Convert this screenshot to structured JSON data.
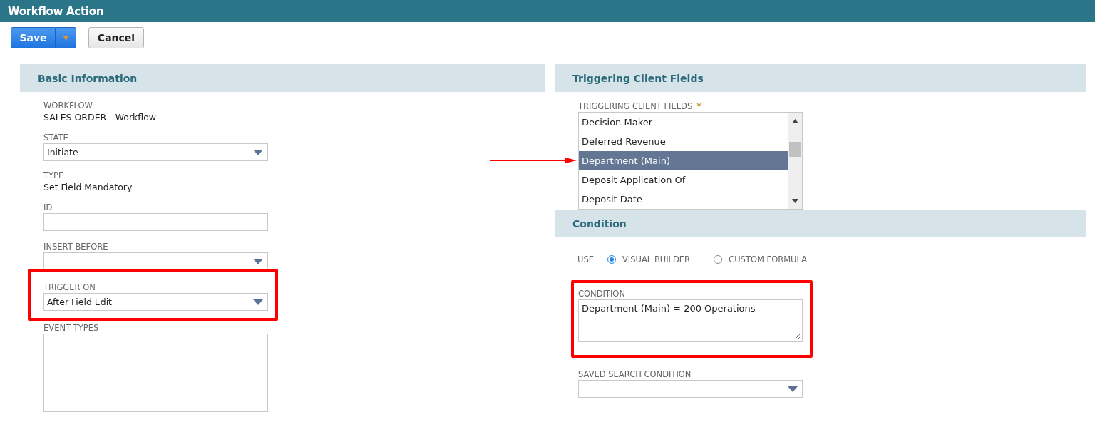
{
  "window": {
    "title": "Workflow Action"
  },
  "toolbar": {
    "save": "Save",
    "cancel": "Cancel"
  },
  "basic_information": {
    "title": "Basic Information",
    "fields": [
      {
        "kind": "text",
        "label": "WORKFLOW",
        "value": "SALES ORDER - Workflow"
      },
      {
        "kind": "select",
        "label": "STATE",
        "value": "Initiate"
      },
      {
        "kind": "text",
        "label": "TYPE",
        "value": "Set Field Mandatory"
      },
      {
        "kind": "input",
        "label": "ID"
      },
      {
        "kind": "select",
        "label": "INSERT BEFORE"
      },
      {
        "kind": "select",
        "label": "TRIGGER ON",
        "value": "After Field Edit",
        "highlighted": true
      },
      {
        "kind": "textarea",
        "label": "EVENT TYPES"
      }
    ]
  },
  "triggering_client_fields": {
    "title": "Triggering Client Fields",
    "label": "TRIGGERING CLIENT FIELDS",
    "required_mark": "*",
    "items": [
      {
        "label": "Decision Maker",
        "selected": false
      },
      {
        "label": "Deferred Revenue",
        "selected": false
      },
      {
        "label": "Department (Main)",
        "selected": true,
        "pointed": true
      },
      {
        "label": "Deposit Application Of",
        "selected": false
      },
      {
        "label": "Deposit Date",
        "selected": false
      }
    ]
  },
  "condition": {
    "title": "Condition",
    "use_label": "USE",
    "options": [
      {
        "label": "VISUAL BUILDER",
        "selected": true
      },
      {
        "label": "CUSTOM FORMULA",
        "selected": false
      }
    ],
    "condition_label": "CONDITION",
    "condition_value": "Department (Main) = 200 Operations",
    "condition_highlighted": true,
    "saved_search_label": "SAVED SEARCH CONDITION"
  }
}
